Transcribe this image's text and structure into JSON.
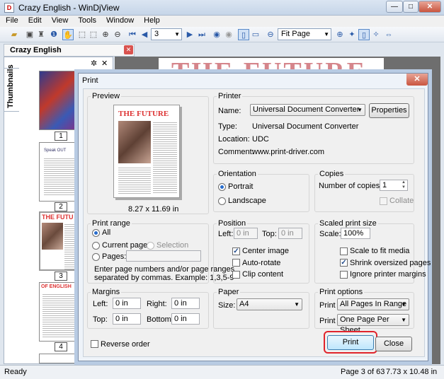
{
  "window": {
    "title": "Crazy English - WinDjView",
    "min": "—",
    "max": "□",
    "close": "✕"
  },
  "menu": [
    "File",
    "Edit",
    "View",
    "Tools",
    "Window",
    "Help"
  ],
  "toolbar": {
    "page_value": "3",
    "zoom_value": "Fit Page"
  },
  "tab": {
    "label": "Crazy English",
    "close": "✕"
  },
  "sidebar": {
    "vtab_label": "Thumbnails",
    "gear": "✲",
    "close": "✕",
    "thumbs": [
      {
        "num": "1"
      },
      {
        "num": "2"
      },
      {
        "num": "3"
      },
      {
        "num": "4"
      }
    ],
    "thumb_texts": {
      "t2_title": "Speak OUT",
      "t3_title": "THE FUTU",
      "t4_title": "OF ENGLISH"
    }
  },
  "document": {
    "headline": "THE FUTURE"
  },
  "status": {
    "left": "Ready",
    "page": "Page 3 of 63",
    "size": "7.73 x 10.48 in"
  },
  "dialog": {
    "title": "Print",
    "close": "✕",
    "preview": {
      "label": "Preview",
      "headline": "THE FUTURE",
      "size": "8.27 x 11.69 in"
    },
    "printer": {
      "label": "Printer",
      "name_label": "Name:",
      "name_value": "Universal Document Converter",
      "properties": "Properties",
      "type_label": "Type:",
      "type_value": "Universal Document Converter",
      "location_label": "Location:",
      "location_value": "UDC",
      "comment_label": "Comment:",
      "comment_value": "www.print-driver.com"
    },
    "orientation": {
      "label": "Orientation",
      "portrait": "Portrait",
      "landscape": "Landscape",
      "selected": "Portrait"
    },
    "copies": {
      "label": "Copies",
      "num_label": "Number of copies:",
      "num_value": "1",
      "collate": "Collate"
    },
    "print_range": {
      "label": "Print range",
      "all": "All",
      "current": "Current page",
      "selection": "Selection",
      "pages": "Pages:",
      "hint1": "Enter page numbers and/or page ranges",
      "hint2": "separated by commas. Example: 1,3,5-9"
    },
    "position": {
      "label": "Position",
      "left_label": "Left:",
      "left_value": "0 in",
      "top_label": "Top:",
      "top_value": "0 in",
      "center": "Center image",
      "autorotate": "Auto-rotate",
      "clip": "Clip content"
    },
    "scaled": {
      "label": "Scaled print size",
      "scale_label": "Scale:",
      "scale_value": "100%",
      "fit": "Scale to fit media",
      "shrink": "Shrink oversized pages",
      "ignore": "Ignore printer margins"
    },
    "margins": {
      "label": "Margins",
      "left_label": "Left:",
      "left_value": "0 in",
      "right_label": "Right:",
      "right_value": "0 in",
      "top_label": "Top:",
      "top_value": "0 in",
      "bottom_label": "Bottom:",
      "bottom_value": "0 in"
    },
    "paper": {
      "label": "Paper",
      "size_label": "Size:",
      "size_value": "A4"
    },
    "options": {
      "label": "Print options",
      "print1_label": "Print",
      "print1_value": "All Pages In Range",
      "print2_label": "Print",
      "print2_value": "One Page Per Sheet"
    },
    "reverse": "Reverse order",
    "print_button": "Print",
    "close_button": "Close"
  },
  "colors": {
    "highlight": "#e0242c",
    "headline": "#d5858b",
    "accent": "#2a6dcc"
  }
}
